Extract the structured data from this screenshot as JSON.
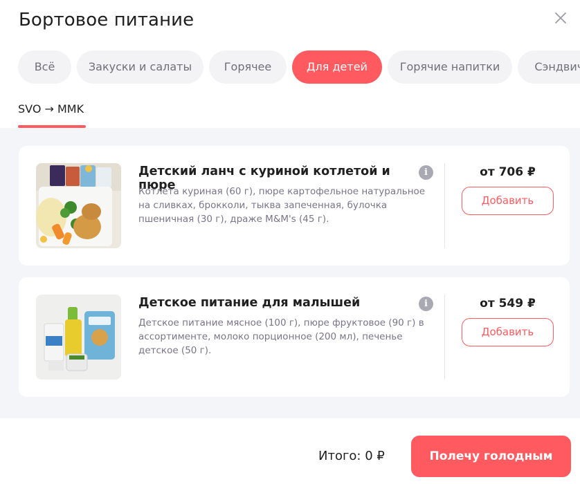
{
  "dialog": {
    "title": "Бортовое питание"
  },
  "tabs": [
    {
      "label": "Всё"
    },
    {
      "label": "Закуски и салаты"
    },
    {
      "label": "Горячее"
    },
    {
      "label": "Для детей"
    },
    {
      "label": "Горячие напитки"
    },
    {
      "label": "Сэндвичи"
    }
  ],
  "route": {
    "label": "SVO → MMK"
  },
  "products": [
    {
      "name": "Детский ланч с куриной котлетой и пюре",
      "description": "Котлета куриная (60 г), пюре картофельное натуральное на сливках, брокколи, тыква запеченная, булочка пшеничная (30 г), драже M&M's (45 г).",
      "price": "от 706 ₽",
      "add_label": "Добавить"
    },
    {
      "name": "Детское питание для малышей",
      "description": "Детское питание мясное (100 г), пюре фруктовое (90 г) в ассортименте, молоко порционное (200 мл), печенье детское (50 г).",
      "price": "от 549 ₽",
      "add_label": "Добавить"
    }
  ],
  "footer": {
    "total": "Итого:  0 ₽",
    "button_label": "Полечу голодным"
  },
  "colors": {
    "accent": "#ff5a5f",
    "tab_bg": "#f3f3f5",
    "content_bg": "#f3f5f9"
  }
}
